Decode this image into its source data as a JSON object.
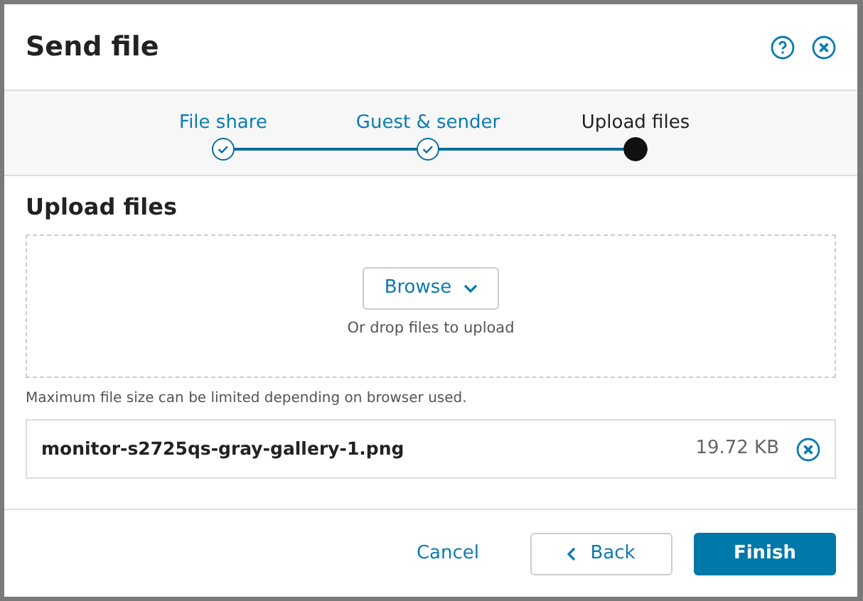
{
  "dialog": {
    "title": "Send file"
  },
  "steps": [
    {
      "label": "File share",
      "done": true,
      "selected": false
    },
    {
      "label": "Guest & sender",
      "done": true,
      "selected": false
    },
    {
      "label": "Upload files",
      "done": false,
      "selected": true
    }
  ],
  "section": {
    "title": "Upload files"
  },
  "dropzone": {
    "button": "Browse",
    "hint": "Or drop files to upload"
  },
  "note": "Maximum file size can be limited depending on browser used.",
  "files": [
    {
      "name": "monitor-s2725qs-gray-gallery-1.png",
      "size": "19.72 KB"
    }
  ],
  "footer": {
    "cancel": "Cancel",
    "back": "Back",
    "finish": "Finish"
  }
}
